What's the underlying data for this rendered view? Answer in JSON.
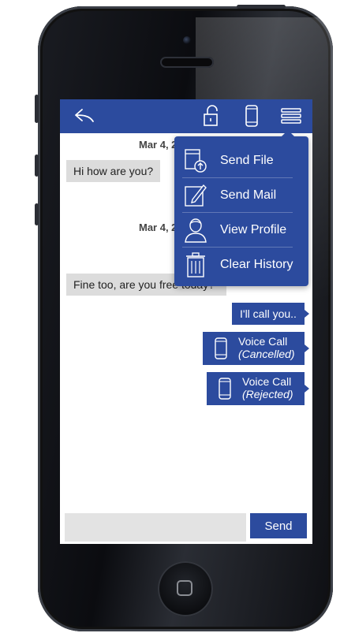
{
  "header": {
    "back_icon": "reply-arrow-icon",
    "lock_icon": "unlock-icon",
    "phone_icon": "mobile-phone-icon",
    "menu_icon": "hamburger-menu-icon"
  },
  "messages": [
    {
      "type": "date",
      "text": "Mar 4, 2"
    },
    {
      "type": "incoming",
      "text": "Hi how are you?"
    },
    {
      "type": "date",
      "text": "Mar 4, 2"
    },
    {
      "type": "incoming",
      "text": "Fine too, are you free today?"
    },
    {
      "type": "outgoing",
      "text": "I'll call you.."
    },
    {
      "type": "call",
      "title": "Voice Call",
      "status": "(Cancelled)"
    },
    {
      "type": "call",
      "title": "Voice Call",
      "status": "(Rejected)"
    }
  ],
  "menu": {
    "items": [
      {
        "label": "Send File",
        "icon": "file-upload-icon"
      },
      {
        "label": "Send Mail",
        "icon": "compose-pencil-icon"
      },
      {
        "label": "View Profile",
        "icon": "user-profile-icon"
      },
      {
        "label": "Clear History",
        "icon": "trash-icon"
      }
    ]
  },
  "composer": {
    "placeholder": "",
    "send_label": "Send"
  },
  "colors": {
    "accent": "#2c4b9e",
    "incoming_bubble": "#dcdcdc"
  }
}
